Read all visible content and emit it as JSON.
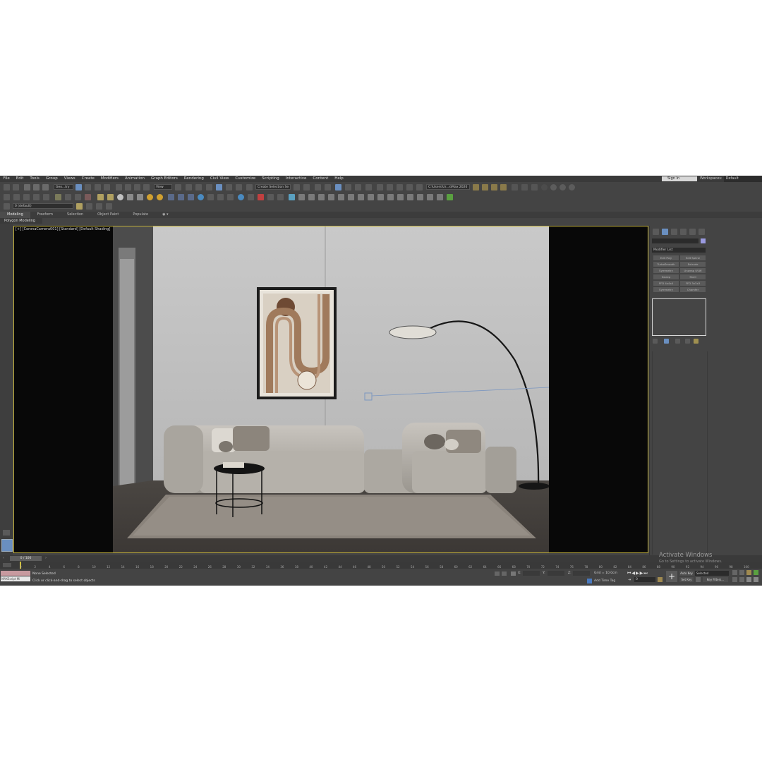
{
  "menubar": {
    "items": [
      "File",
      "Edit",
      "Tools",
      "Group",
      "Views",
      "Create",
      "Modifiers",
      "Animation",
      "Graph Editors",
      "Rendering",
      "Civil View",
      "Customize",
      "Scripting",
      "Interactive",
      "Content",
      "Help"
    ],
    "sign_in": "Sign In",
    "workspaces_label": "Workspaces:",
    "workspaces_value": "Default"
  },
  "toolbar": {
    "selection_filter": "Geo...try",
    "reference_coord": "View",
    "named_selection": "Create Selection Se",
    "project_path": "C:\\Users\\Ur...s\\Max 2020",
    "layer": "0 (default)"
  },
  "ribbon": {
    "tabs": [
      "Modeling",
      "Freeform",
      "Selection",
      "Object Paint",
      "Populate"
    ],
    "active_tab": "Modeling",
    "sub_label": "Polygon Modeling"
  },
  "viewport": {
    "label": "[+] [CoronaCamera001] [Standard] [Default Shading]"
  },
  "command_panel": {
    "modifier_list": "Modifier List",
    "buttons": [
      "Edit Poly",
      "Edit Spline",
      "TurboSmooth",
      "Extrude",
      "Symmetry",
      "Unwrap UVW",
      "Sweep",
      "Shell",
      "FFD 4x4x4",
      "FFD 3x3x3",
      "Symmetry",
      "Chamfer"
    ]
  },
  "timeline": {
    "frame_display": "0 / 100",
    "ticks": [
      "0",
      "2",
      "4",
      "6",
      "8",
      "10",
      "12",
      "14",
      "16",
      "18",
      "20",
      "22",
      "24",
      "26",
      "28",
      "30",
      "32",
      "34",
      "36",
      "38",
      "40",
      "42",
      "44",
      "46",
      "48",
      "50",
      "52",
      "54",
      "56",
      "58",
      "60",
      "62",
      "64",
      "66",
      "68",
      "70",
      "72",
      "74",
      "76",
      "78",
      "80",
      "82",
      "84",
      "86",
      "88",
      "90",
      "92",
      "94",
      "96",
      "98",
      "100"
    ]
  },
  "status": {
    "maxscript_label": "MAXScript Mi",
    "selection": "None Selected",
    "prompt": "Click or click-and-drag to select objects",
    "x_label": "X:",
    "y_label": "Y:",
    "z_label": "Z:",
    "grid": "Grid = 10.0cm",
    "add_time_tag": "Add Time Tag",
    "auto_key": "Auto Key",
    "set_key": "Set Key",
    "selected": "Selected",
    "key_filters": "Key Filters...",
    "current_frame": "0"
  },
  "watermark": {
    "title": "Activate Windows",
    "subtitle": "Go to Settings to activate Windows."
  }
}
